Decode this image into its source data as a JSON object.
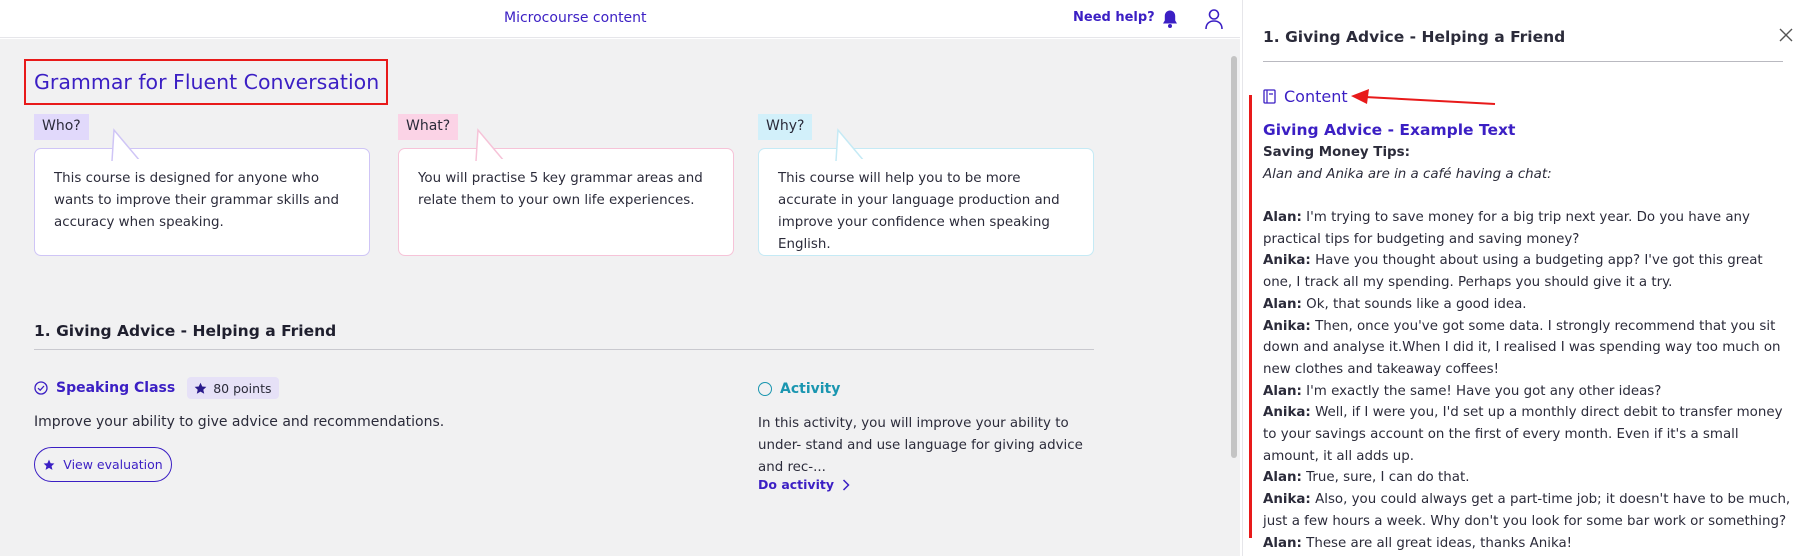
{
  "header": {
    "center_title": "Microcourse content",
    "help_label": "Need help?"
  },
  "course": {
    "title": "Grammar for Fluent Conversation",
    "cards": [
      {
        "tag": "Who?",
        "text": "This course is designed for anyone who wants to improve their grammar skills and accuracy when speaking."
      },
      {
        "tag": "What?",
        "text": "You will practise 5 key grammar areas and relate them to your own life experiences."
      },
      {
        "tag": "Why?",
        "text": "This course will help you to be more accurate in your language production and improve your confidence when speaking English."
      }
    ]
  },
  "section": {
    "title": "1. Giving Advice - Helping a Friend",
    "speaking_class": {
      "label": "Speaking Class",
      "points": "80 points",
      "description": "Improve your ability to give advice and recommendations.",
      "button_label": "View evaluation"
    },
    "activity": {
      "label": "Activity",
      "description": "In this activity, you will improve your ability to under- stand and use language for giving advice and rec-...",
      "link_label": "Do activity"
    }
  },
  "panel": {
    "title": "1. Giving Advice - Helping a Friend",
    "content_label": "Content",
    "example_title": "Giving Advice - Example Text",
    "example_subtitle": "Saving Money Tips:",
    "example_intro": "Alan and Anika are in a café having a chat:",
    "dialogue": [
      {
        "speaker": "Alan:",
        "text": "I'm trying to save money for a big trip next year. Do you have any practical tips for budgeting and saving money?"
      },
      {
        "speaker": "Anika:",
        "text": "Have you thought about using a budgeting app? I've got this great one, I track all my spending. Perhaps you should give it a try."
      },
      {
        "speaker": "Alan:",
        "text": "Ok, that sounds like a good idea."
      },
      {
        "speaker": "Anika:",
        "text": "Then, once you've got some data. I strongly recommend that you sit down and analyse it.When I did it, I realised I was spending way too much on new clothes and takeaway coffees!"
      },
      {
        "speaker": "Alan:",
        "text": "I'm exactly the same! Have you got any other ideas?"
      },
      {
        "speaker": "Anika:",
        "text": "Well, if I were you, I'd set up a monthly direct debit to transfer money to your savings account on the first of every month. Even if it's a small amount, it all adds up."
      },
      {
        "speaker": "Alan:",
        "text": "True, sure, I can do that."
      },
      {
        "speaker": "Anika:",
        "text": "Also, you could always get a part-time job; it doesn't have to be much, just a few hours a week. Why don't you look for some bar work or something?"
      },
      {
        "speaker": "Alan:",
        "text": "These are all great ideas, thanks Anika!"
      }
    ]
  },
  "colors": {
    "brand": "#3b1fc4",
    "activity": "#1a96b0",
    "annotation": "#e81a1a"
  }
}
